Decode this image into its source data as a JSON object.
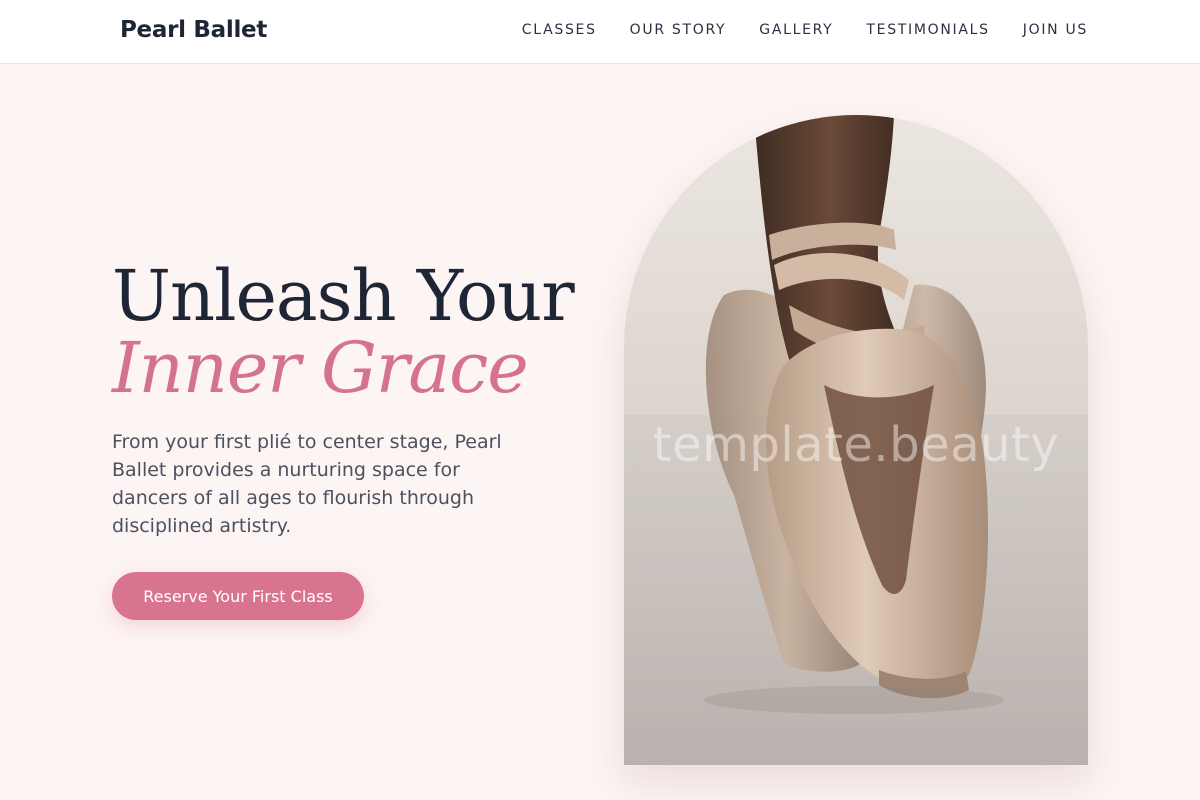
{
  "header": {
    "brand": "Pearl Ballet",
    "nav": [
      "CLASSES",
      "OUR STORY",
      "GALLERY",
      "TESTIMONIALS",
      "JOIN US"
    ]
  },
  "hero": {
    "title_line1": "Unleash Your",
    "title_line2": "Inner Grace",
    "description": "From your first plié to center stage, Pearl Ballet provides a nurturing space for dancers of all ages to flourish through disciplined artistry.",
    "cta_label": "Reserve Your First Class",
    "image_alt": "Ballet dancer en pointe in satin pointe shoes",
    "watermark": "template.beauty"
  },
  "colors": {
    "page_background": "#fdf4f4",
    "header_background": "#ffffff",
    "heading_dark": "#1e2535",
    "accent_pink": "#d9748f",
    "body_text": "#4c5160"
  }
}
